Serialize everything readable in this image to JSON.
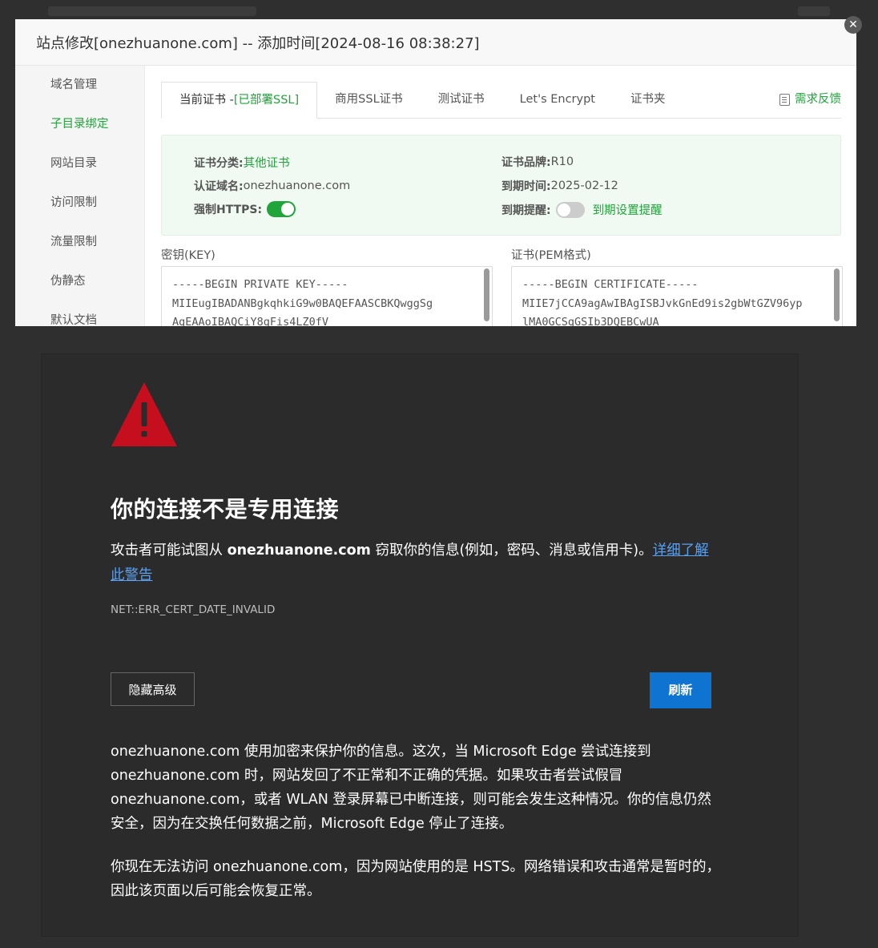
{
  "modal": {
    "title": "站点修改[onezhuanone.com] -- 添加时间[2024-08-16 08:38:27]",
    "close_glyph": "✕",
    "sidebar": [
      {
        "label": "域名管理",
        "active": false
      },
      {
        "label": "子目录绑定",
        "active": true
      },
      {
        "label": "网站目录",
        "active": false
      },
      {
        "label": "访问限制",
        "active": false
      },
      {
        "label": "流量限制",
        "active": false
      },
      {
        "label": "伪静态",
        "active": false
      },
      {
        "label": "默认文档",
        "active": false
      }
    ],
    "tabs": {
      "current_prefix": "当前证书 -",
      "current_status": "[已部署SSL]",
      "commercial": "商用SSL证书",
      "test": "测试证书",
      "letsencrypt": "Let's Encrypt",
      "folder": "证书夹",
      "feedback": "需求反馈"
    },
    "cert": {
      "category_label": "证书分类:",
      "category_value": "其他证书",
      "brand_label": "证书品牌:",
      "brand_value": "R10",
      "domain_label": "认证域名:",
      "domain_value": "onezhuanone.com",
      "expiry_label": "到期时间:",
      "expiry_value": "2025-02-12",
      "https_label": "强制HTTPS:",
      "https_on": true,
      "reminder_label": "到期提醒:",
      "reminder_on": false,
      "reminder_link": "到期设置提醒"
    },
    "key": {
      "label": "密钥(KEY)",
      "line1": "-----BEGIN PRIVATE KEY-----",
      "line2": "MIIEugIBADANBgkqhkiG9w0BAQEFAASCBKQwggSg",
      "line3": "AgEAAoIBAQCiY8qFis4LZ0fV"
    },
    "pem": {
      "label": "证书(PEM格式)",
      "line1": "-----BEGIN CERTIFICATE-----",
      "line2": "MIIE7jCCA9agAwIBAgISBJvkGnEd9is2gbWtGZV96yp",
      "line3": "lMA0GCSqGSIb3DQEBCwUA"
    }
  },
  "error_page": {
    "title": "你的连接不是专用连接",
    "desc_prefix": "攻击者可能试图从 ",
    "desc_domain": "onezhuanone.com",
    "desc_suffix": " 窃取你的信息(例如，密码、消息或信用卡)。",
    "learn_more": "详细了解此警告",
    "error_code": "NET::ERR_CERT_DATE_INVALID",
    "hide_advanced": "隐藏高级",
    "refresh": "刷新",
    "paragraph1": "onezhuanone.com 使用加密来保护你的信息。这次，当 Microsoft Edge 尝试连接到 onezhuanone.com 时，网站发回了不正常和不正确的凭据。如果攻击者尝试假冒 onezhuanone.com，或者 WLAN 登录屏幕已中断连接，则可能会发生这种情况。你的信息仍然安全，因为在交换任何数据之前，Microsoft Edge 停止了连接。",
    "paragraph2": "你现在无法访问 onezhuanone.com，因为网站使用的是 HSTS。网络错误和攻击通常是暂时的，因此该页面以后可能会恢复正常。"
  },
  "colors": {
    "accent_green": "#20a53a",
    "link_blue": "#5aa0ef",
    "primary_button": "#0f74d1",
    "warning_red": "#c50f1f",
    "dark_bg": "#2b2b2b"
  }
}
